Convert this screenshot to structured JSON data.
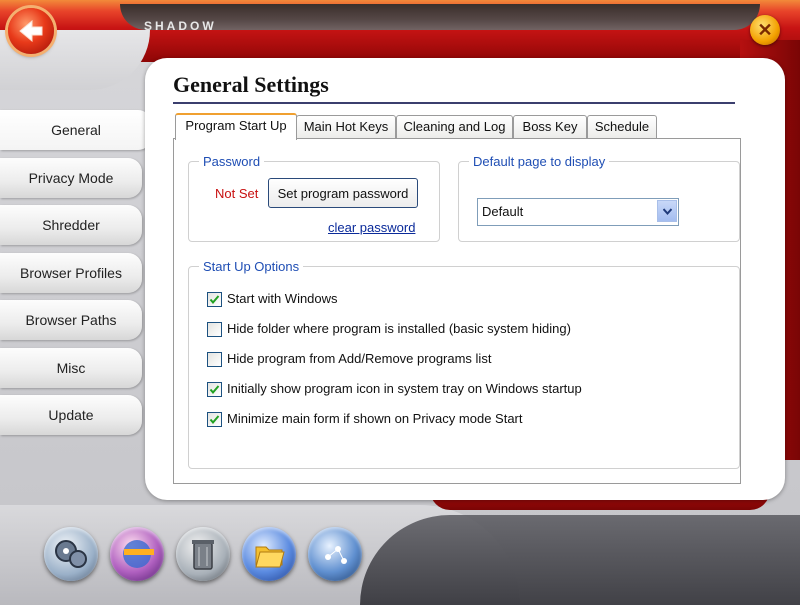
{
  "app": {
    "title": "SHADOW"
  },
  "window_controls": {
    "close_glyph": "✕"
  },
  "nav": {
    "items": [
      {
        "label": "General",
        "active": true
      },
      {
        "label": "Privacy Mode"
      },
      {
        "label": "Shredder"
      },
      {
        "label": "Browser Profiles"
      },
      {
        "label": "Browser Paths"
      },
      {
        "label": "Misc"
      },
      {
        "label": "Update"
      }
    ]
  },
  "main": {
    "title": "General Settings",
    "tabs": [
      {
        "label": "Program Start Up",
        "active": true
      },
      {
        "label": "Main Hot Keys"
      },
      {
        "label": "Cleaning and Log"
      },
      {
        "label": "Boss Key"
      },
      {
        "label": "Schedule"
      }
    ],
    "password": {
      "legend": "Password",
      "status": "Not Set",
      "set_button": "Set program password",
      "clear_link": "clear password"
    },
    "default_page": {
      "legend": "Default page to display",
      "selected": "Default"
    },
    "startup": {
      "legend": "Start Up Options",
      "options": [
        {
          "label": "Start with Windows",
          "checked": true
        },
        {
          "label": "Hide folder where program is installed (basic system hiding)",
          "checked": false
        },
        {
          "label": "Hide program from Add/Remove programs list",
          "checked": false
        },
        {
          "label": "Initially show program icon in system tray on Windows startup",
          "checked": true
        },
        {
          "label": "Minimize main form if shown on Privacy mode Start",
          "checked": true
        }
      ]
    }
  },
  "dock": {
    "icons": [
      "film-reel-icon",
      "privacy-globe-icon",
      "trash-can-icon",
      "folders-icon",
      "network-icon"
    ]
  },
  "colors": {
    "accent_red": "#c81414",
    "legend_blue": "#1f4eb4",
    "link_blue": "#0a2a9a",
    "tab_active_border": "#f0a030"
  }
}
